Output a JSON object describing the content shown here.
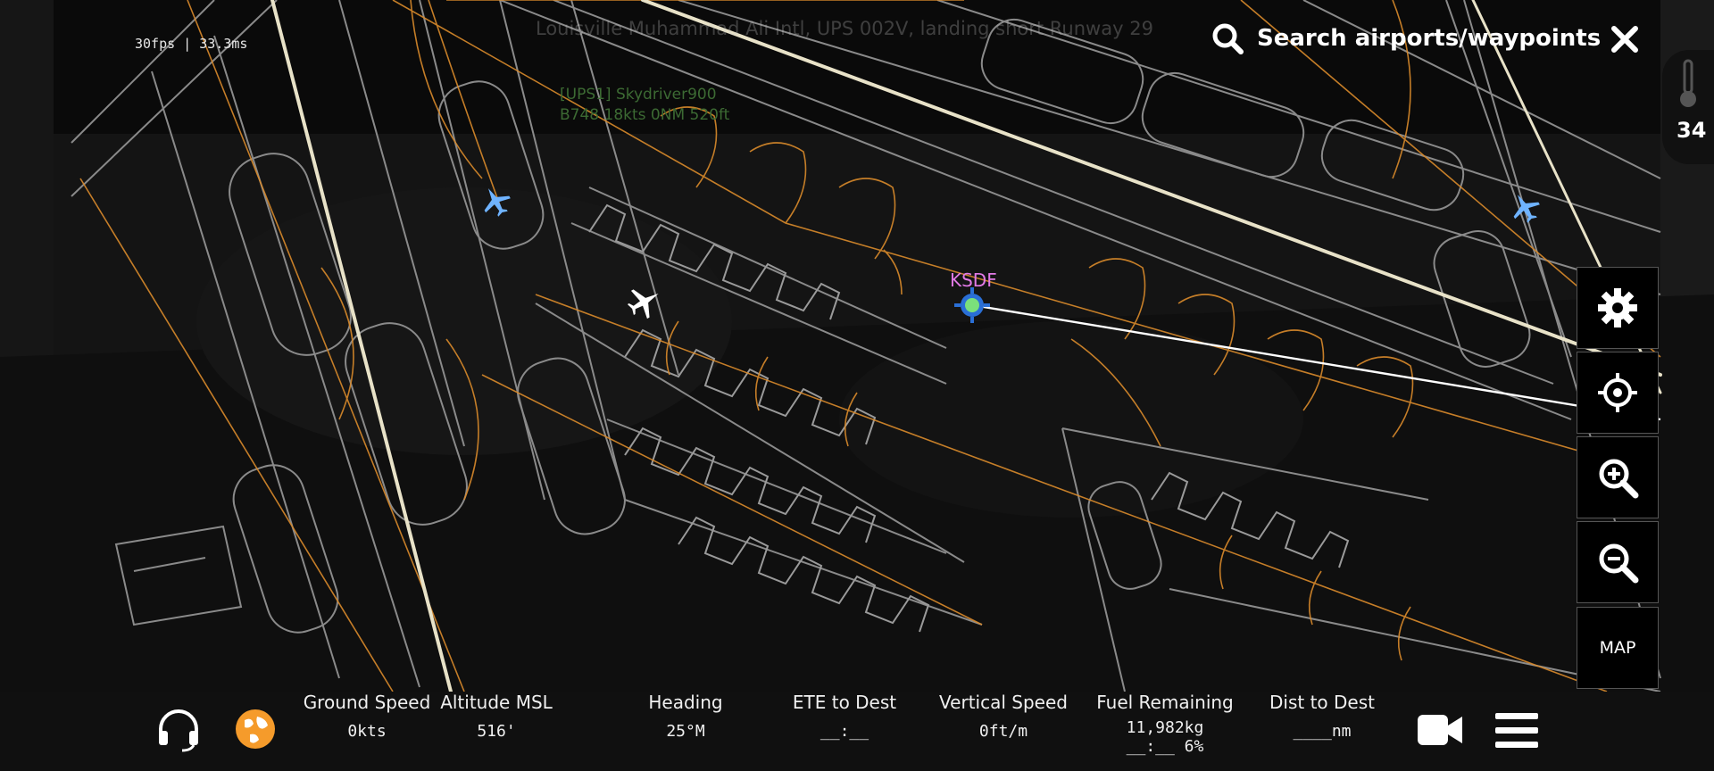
{
  "perf": {
    "fps_readout": "30fps | 33.3ms"
  },
  "atc": {
    "message": "Louisville Muhammad Ali Intl, UPS 002V, landing short Runway 29"
  },
  "traffic": {
    "callsign": "[UPS1] Skydriver900",
    "details": "B748 18kts 0NM 520ft"
  },
  "search": {
    "label": "Search airports/waypoints",
    "icon": "search-icon"
  },
  "weather": {
    "temperature": "34",
    "icon": "thermometer-icon"
  },
  "map": {
    "airport_label": "KSDF",
    "colors": {
      "taxiway": "#d98a2b",
      "apron": "#8a8a8a",
      "runway": "#e8e2c8",
      "route": "#ffffff",
      "airport": "#e27ae6",
      "ai_traffic": "#6fb3ff"
    }
  },
  "side_buttons": {
    "settings_icon": "gear-icon",
    "center_icon": "crosshair-icon",
    "zoom_in_icon": "zoom-in-icon",
    "zoom_out_icon": "zoom-out-icon",
    "map_label": "MAP"
  },
  "bottom_bar": {
    "stats": [
      {
        "label": "Ground Speed",
        "value": "0kts"
      },
      {
        "label": "Altitude MSL",
        "value": "516'"
      },
      {
        "label": "Heading",
        "value": "25°M"
      },
      {
        "label": "ETE to Dest",
        "value": "__:__"
      },
      {
        "label": "Vertical Speed",
        "value": "0ft/m"
      },
      {
        "label": "Fuel Remaining",
        "value": "11,982kg",
        "value2": "__:__ 6%"
      },
      {
        "label": "Dist to Dest",
        "value": "____nm"
      }
    ],
    "left_icons": [
      "headset-icon",
      "globe-icon"
    ],
    "right_icons": [
      "camera-icon",
      "menu-icon"
    ]
  }
}
